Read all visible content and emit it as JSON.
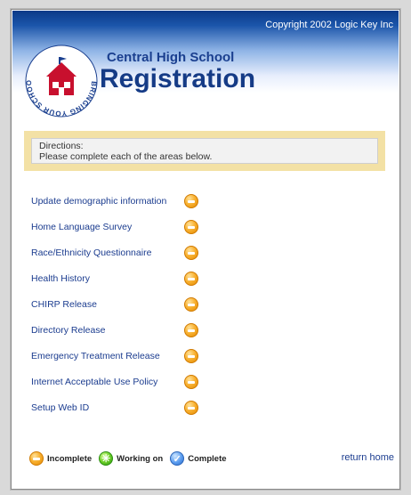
{
  "header": {
    "copyright": "Copyright 2002 Logic Key Inc",
    "school": "Central High School",
    "title": "Registration",
    "logo_text": "BRINGING YOUR SCHOOL TOGETHER"
  },
  "directions": {
    "heading": "Directions:",
    "text": "Please complete each of the areas below."
  },
  "tasks": [
    {
      "label": "Update demographic information",
      "status": "incomplete"
    },
    {
      "label": "Home Language Survey",
      "status": "incomplete"
    },
    {
      "label": "Race/Ethnicity Questionnaire",
      "status": "incomplete"
    },
    {
      "label": "Health History",
      "status": "incomplete"
    },
    {
      "label": "CHIRP Release",
      "status": "incomplete"
    },
    {
      "label": "Directory Release",
      "status": "incomplete"
    },
    {
      "label": "Emergency Treatment Release",
      "status": "incomplete"
    },
    {
      "label": "Internet Acceptable Use Policy",
      "status": "incomplete"
    },
    {
      "label": "Setup Web ID",
      "status": "incomplete"
    }
  ],
  "legend": {
    "incomplete": "Incomplete",
    "working": "Working on",
    "complete": "Complete"
  },
  "footer": {
    "return_home": "return home"
  },
  "colors": {
    "link": "#1b3c8f",
    "header_blue": "#0b3a88",
    "directions_border": "#f3e1a5"
  }
}
